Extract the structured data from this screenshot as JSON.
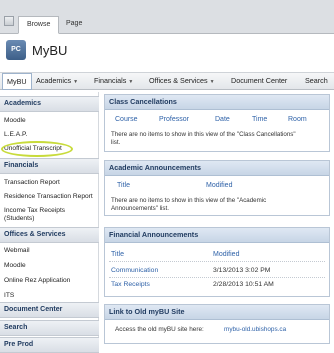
{
  "ribbon": {
    "tabs": [
      "Browse",
      "Page"
    ]
  },
  "header": {
    "logo_text": "PC",
    "site_title": "MyBU"
  },
  "topnav": {
    "items": [
      {
        "label": "MyBU"
      },
      {
        "label": "Academics",
        "dropdown": true
      },
      {
        "label": "Financials",
        "dropdown": true
      },
      {
        "label": "Offices & Services",
        "dropdown": true
      },
      {
        "label": "Document Center"
      },
      {
        "label": "Search"
      }
    ]
  },
  "sidebar": {
    "academics": {
      "heading": "Academics",
      "items": [
        "Moodle",
        "L.E.A.P.",
        "Unofficial Transcript"
      ]
    },
    "financials": {
      "heading": "Financials",
      "items": [
        "Transaction Report",
        "Residence Transaction Report",
        "Income Tax Receipts",
        "(Students)"
      ]
    },
    "offices": {
      "heading": "Offices & Services",
      "items": [
        "Webmail",
        "Moodle",
        "Online Rez Application",
        "ITS"
      ]
    },
    "document_center": {
      "heading": "Document Center"
    },
    "search": {
      "heading": "Search"
    },
    "pre_prod": {
      "heading": "Pre Prod"
    }
  },
  "class_cancellations": {
    "title": "Class Cancellations",
    "columns": [
      "Course",
      "Professor",
      "Date",
      "Time",
      "Room"
    ],
    "empty_message_1": "There are no items to show in this view of the \"Class Cancellations\"",
    "empty_message_2": "list."
  },
  "academic_announcements": {
    "title": "Academic Announcements",
    "columns": [
      "Title",
      "Modified"
    ],
    "empty_message_1": "There are no items to show in this view of the \"Academic",
    "empty_message_2": "Announcements\" list."
  },
  "financial_announcements": {
    "title": "Financial Announcements",
    "columns": [
      "Title",
      "Modified"
    ],
    "rows": [
      {
        "title": "Communication",
        "modified": "3/13/2013 3:02 PM"
      },
      {
        "title": "Tax Receipts",
        "modified": "2/28/2013 10:51 AM"
      }
    ]
  },
  "old_site": {
    "title": "Link to Old myBU Site",
    "text": "Access the old myBU site here:",
    "link": "mybu-old.ubishops.ca"
  }
}
